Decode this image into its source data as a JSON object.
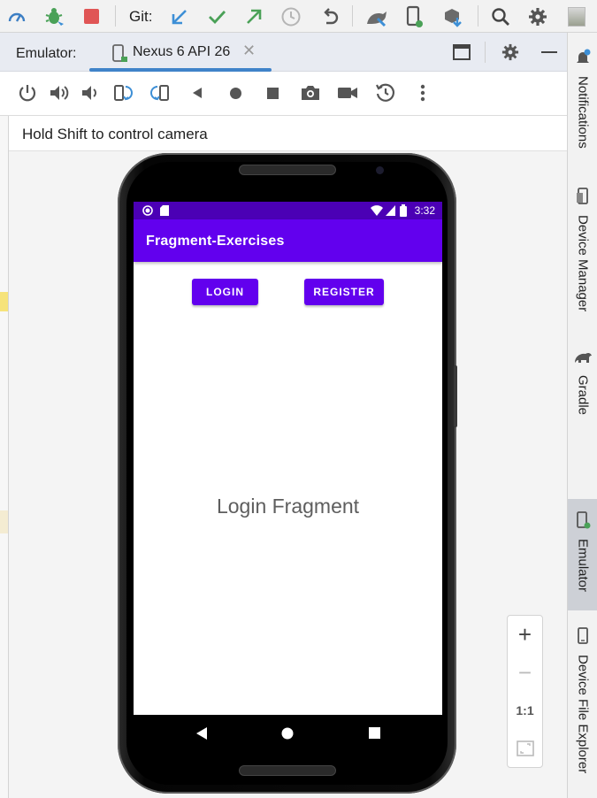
{
  "toolbar": {
    "git_label": "Git:",
    "icons": [
      "profiler-icon",
      "debug-icon",
      "stop-icon",
      "git-update-icon",
      "git-commit-icon",
      "git-push-icon",
      "git-history-icon",
      "undo-icon",
      "device-manager-icon",
      "running-devices-icon",
      "sdk-manager-icon",
      "search-icon",
      "settings-icon",
      "avatar"
    ]
  },
  "emulator_header": {
    "title": "Emulator:",
    "device_tab": "Nexus 6 API 26",
    "close_glyph": "✕"
  },
  "controls": [
    "power-icon",
    "volume-up-icon",
    "volume-down-icon",
    "rotate-left-icon",
    "rotate-right-icon",
    "back-icon",
    "home-icon",
    "overview-icon",
    "screenshot-icon",
    "record-icon",
    "snapshot-icon",
    "more-icon"
  ],
  "hint": "Hold Shift to control camera",
  "device": {
    "status_time": "3:32",
    "app_title": "Fragment-Exercises",
    "login_button": "LOGIN",
    "register_button": "REGISTER",
    "fragment_text": "Login Fragment"
  },
  "zoom": {
    "zoom_in": "+",
    "zoom_out": "−",
    "actual_size": "1:1"
  },
  "right_tabs": {
    "notifications": "Notifications",
    "device_manager": "Device Manager",
    "gradle": "Gradle",
    "emulator": "Emulator",
    "device_file_explorer": "Device File Explorer"
  },
  "colors": {
    "app_bar": "#6200ee",
    "status_bar": "#4b00b5",
    "tab_underline": "#4083c9",
    "git_update": "#3d8fd6",
    "git_commit": "#4aa157",
    "stop": "#e05555"
  }
}
